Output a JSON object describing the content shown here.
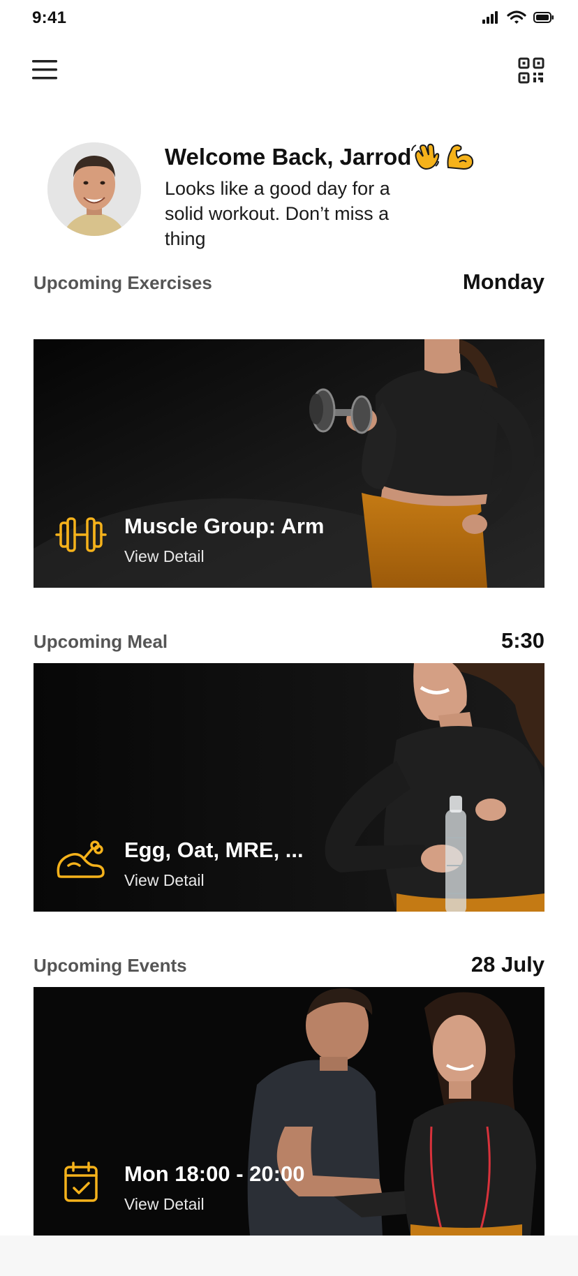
{
  "status": {
    "time": "9:41"
  },
  "welcome": {
    "title": "Welcome Back, Jarrod",
    "emojis": [
      "waving-hand",
      "flexed-biceps"
    ],
    "subtitle": "Looks like a good day for a solid workout. Don’t miss a thing"
  },
  "sections": [
    {
      "label": "Upcoming Exercises",
      "value": "Monday",
      "card_title": "Muscle Group: Arm",
      "card_link": "View Detail",
      "icon": "dumbbell-icon"
    },
    {
      "label": "Upcoming Meal",
      "value": "5:30",
      "card_title": "Egg, Oat, MRE, ...",
      "card_link": "View Detail",
      "icon": "chicken-leg-icon"
    },
    {
      "label": "Upcoming Events",
      "value": "28 July",
      "card_title": "Mon 18:00 - 20:00",
      "card_link": "View Detail",
      "icon": "calendar-check-icon"
    }
  ],
  "colors": {
    "accent": "#F5B21B",
    "card_bg": "#0b0b0b",
    "label": "#555555"
  }
}
